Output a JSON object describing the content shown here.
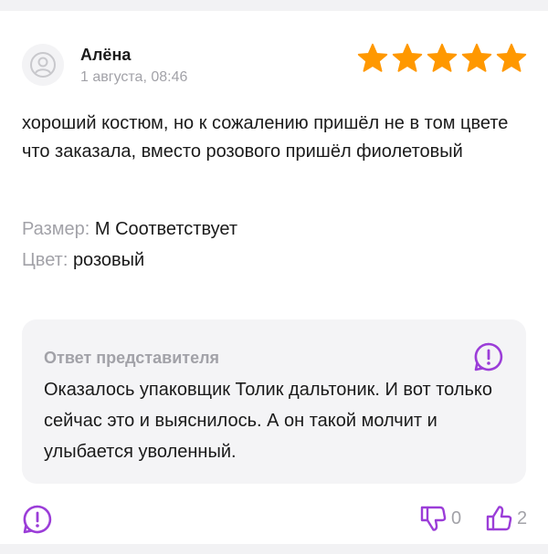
{
  "colors": {
    "accent": "#9b3dd8",
    "star": "#ff9800",
    "muted": "#a2a2a8",
    "text": "#1a1a1a"
  },
  "review": {
    "author": "Алёна",
    "date": "1 августа, 08:46",
    "rating": 5,
    "text": "хороший костюм, но к сожалению пришёл не в том цвете что заказала, вместо розового пришёл фиолетовый",
    "params": [
      {
        "label": "Размер:",
        "value": "M Соответствует"
      },
      {
        "label": "Цвет:",
        "value": "розовый"
      }
    ]
  },
  "reply": {
    "title": "Ответ представителя",
    "text": "Оказалось упаковщик Толик дальтоник. И вот только сейчас это и выяснилось. А он такой молчит и улыбается уволенный."
  },
  "votes": {
    "dislikes": "0",
    "likes": "2"
  },
  "icons": [
    "user-avatar-icon",
    "star-icon",
    "report-icon",
    "thumbs-down-icon",
    "thumbs-up-icon"
  ]
}
